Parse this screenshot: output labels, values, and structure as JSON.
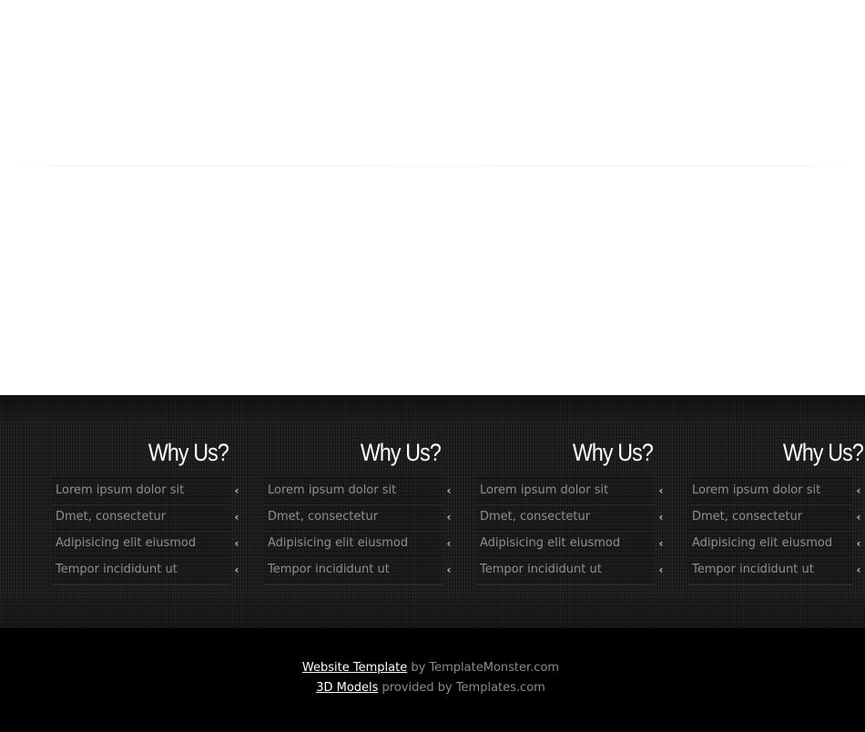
{
  "columns": [
    {
      "title": "Why Us?",
      "items": [
        {
          "label": "Lorem ipsum dolor sit",
          "icon": "chevron-left-icon"
        },
        {
          "label": "Dmet, consectetur",
          "icon": "chevron-left-icon"
        },
        {
          "label": "Adipisicing elit eiusmod",
          "icon": "chevron-left-icon"
        },
        {
          "label": "Tempor incididunt ut",
          "icon": "chevron-left-icon"
        }
      ]
    },
    {
      "title": "Why Us?",
      "items": [
        {
          "label": "Lorem ipsum dolor sit",
          "icon": "chevron-left-icon"
        },
        {
          "label": "Dmet, consectetur",
          "icon": "chevron-left-icon"
        },
        {
          "label": "Adipisicing elit eiusmod",
          "icon": "chevron-left-icon"
        },
        {
          "label": "Tempor incididunt ut",
          "icon": "chevron-left-icon"
        }
      ]
    },
    {
      "title": "Why Us?",
      "items": [
        {
          "label": "Lorem ipsum dolor sit",
          "icon": "chevron-left-icon"
        },
        {
          "label": "Dmet, consectetur",
          "icon": "chevron-left-icon"
        },
        {
          "label": "Adipisicing elit eiusmod",
          "icon": "chevron-left-icon"
        },
        {
          "label": "Tempor incididunt ut",
          "icon": "chevron-left-icon"
        }
      ]
    },
    {
      "title": "Why Us?",
      "items": [
        {
          "label": "Lorem ipsum dolor sit",
          "icon": "chevron-left-icon"
        },
        {
          "label": "Dmet, consectetur",
          "icon": "chevron-left-icon"
        },
        {
          "label": "Adipisicing elit eiusmod",
          "icon": "chevron-left-icon"
        },
        {
          "label": "Tempor incididunt ut",
          "icon": "chevron-left-icon"
        }
      ]
    }
  ],
  "footer": {
    "template_link": "Website Template",
    "template_by": " by TemplateMonster.com",
    "models_link": "3D Models",
    "models_by": " provided by Templates.com"
  },
  "colors": {
    "band": "#1c1c1c",
    "footer": "#000000",
    "title": "#ffffff",
    "item_text": "#8e8e8e",
    "link": "#ffffff"
  }
}
